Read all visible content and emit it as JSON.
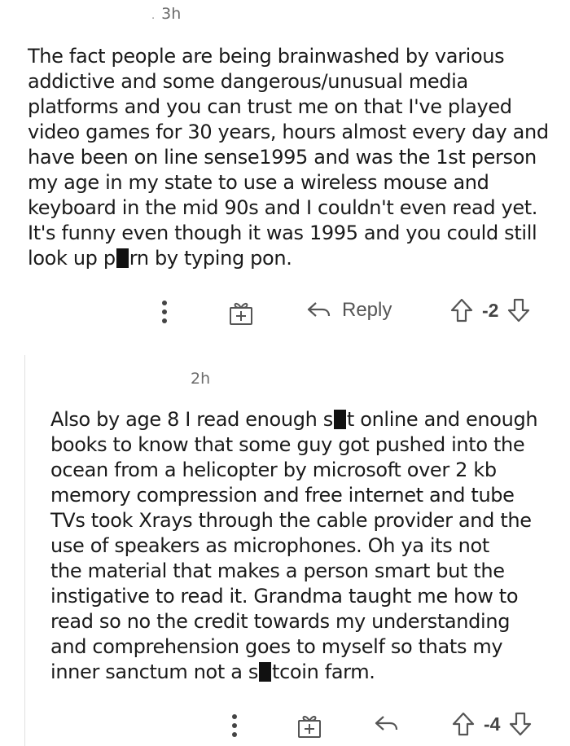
{
  "comments": [
    {
      "time": "3h",
      "lines": [
        "The fact people are being brainwashed by various",
        "addictive and some dangerous/unusual media",
        "platforms and you can trust me on that I've played",
        "video games for 30 years, hours almost every day and",
        "have been on line sense1995 and was the 1st person",
        "my age in my state to use a wireless mouse and",
        "keyboard in the mid 90s and I couldn't even read yet.",
        "It's funny even though it was 1995 and you could still"
      ],
      "last_line_pre": "look up p",
      "last_line_post": "rn by typing pon.",
      "actions": {
        "reply_label": "Reply",
        "score": "-2"
      }
    },
    {
      "time": "2h",
      "line1_pre": "Also by age 8 I read enough s",
      "line1_post": "t online and enough",
      "lines": [
        "books to know that some guy got pushed into the",
        "ocean from a helicopter by microsoft over 2 kb",
        "memory compression and free internet and tube",
        "TVs took Xrays through the cable provider and the",
        "use of speakers as microphones. Oh ya its not",
        "the material that makes a person smart but the",
        "instigative to read it. Grandma taught me how to",
        "read so no the credit towards my understanding",
        "and comprehension goes to myself so thats my"
      ],
      "last_line_pre": "inner sanctum not a s",
      "last_line_post": "tcoin farm.",
      "actions": {
        "score": "-4"
      }
    }
  ],
  "icons": {
    "more": "more-vertical-icon",
    "award": "award-icon",
    "reply": "reply-arrow-icon",
    "upvote": "upvote-arrow-icon",
    "downvote": "downvote-arrow-icon"
  }
}
